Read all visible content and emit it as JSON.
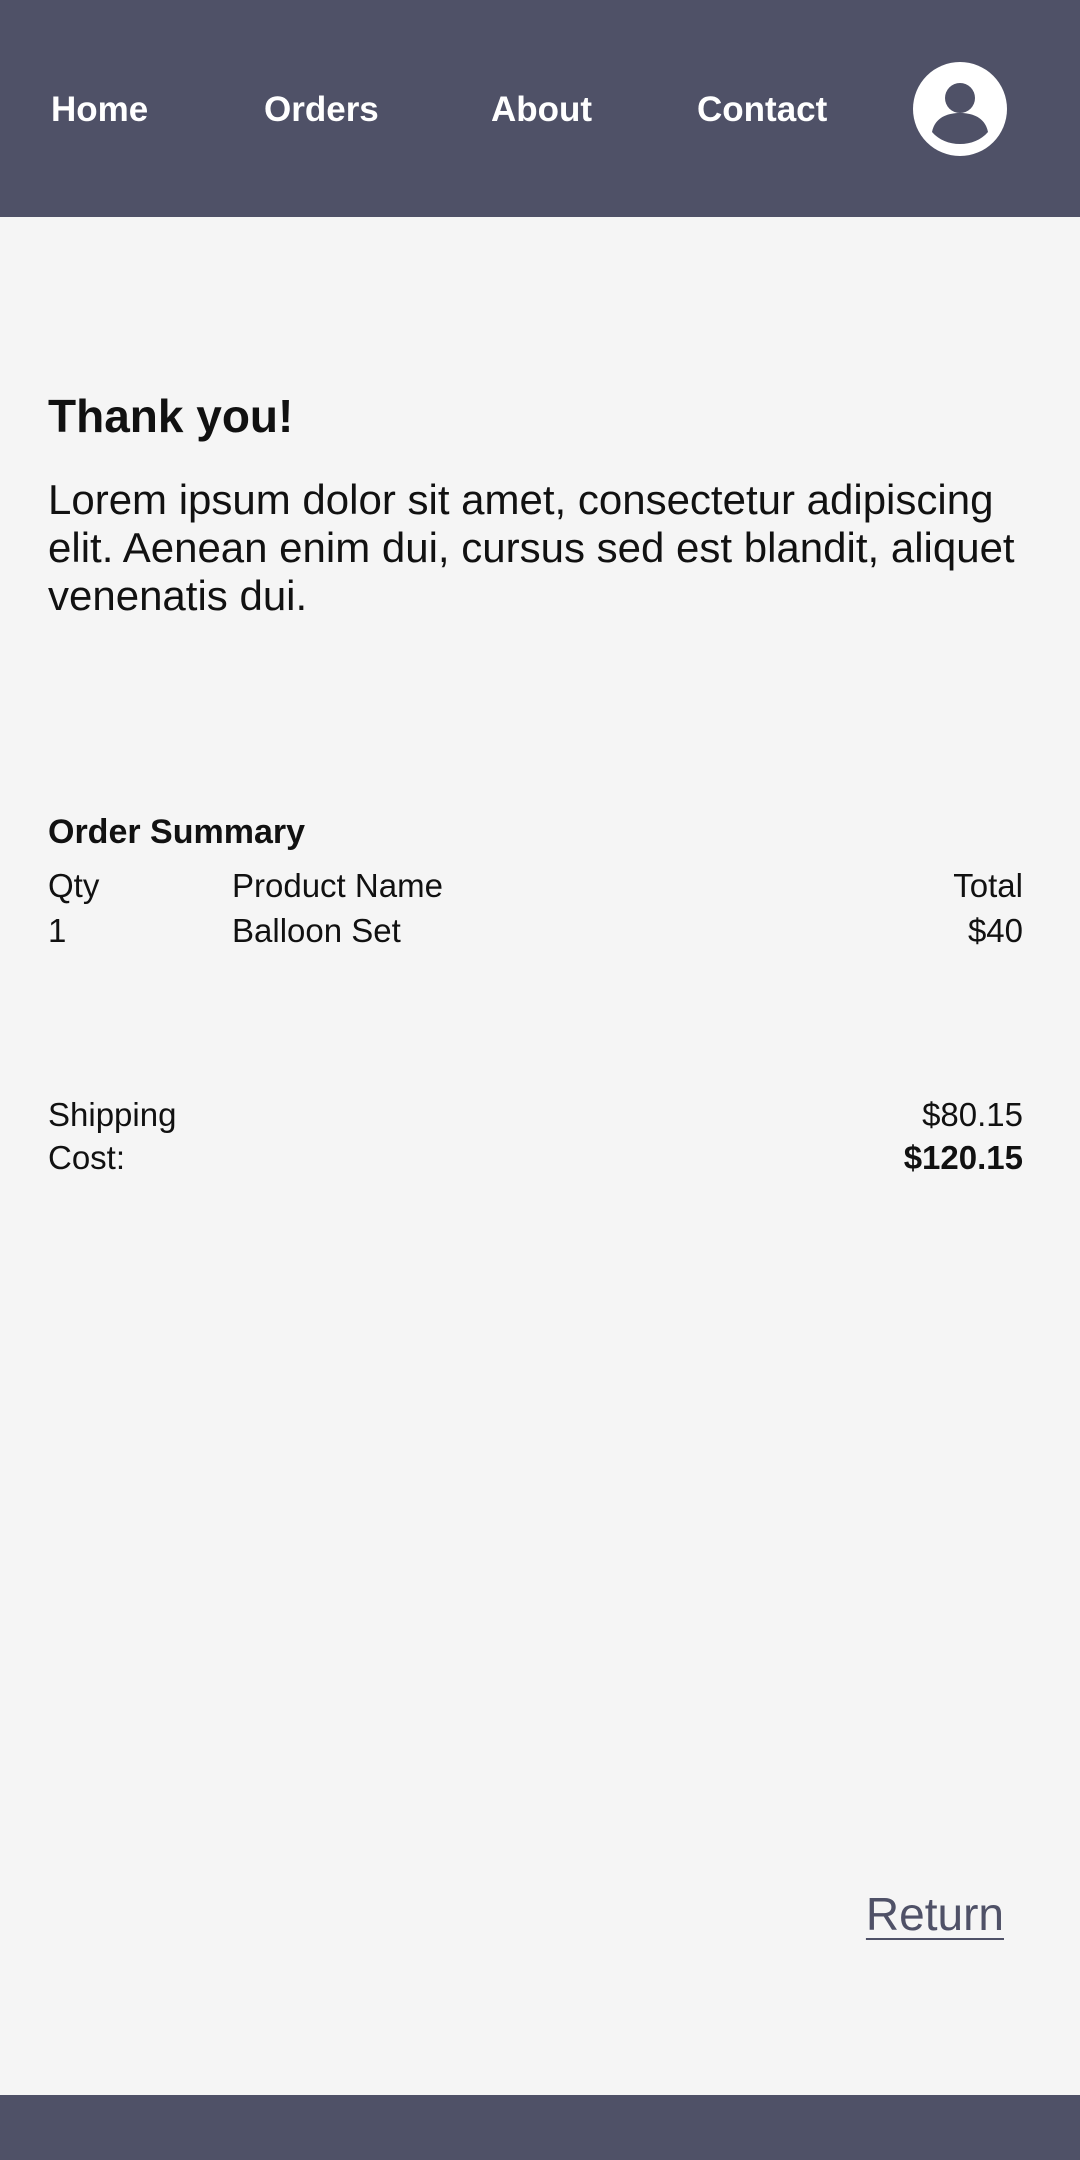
{
  "nav": {
    "items": [
      {
        "label": "Home"
      },
      {
        "label": "Orders"
      },
      {
        "label": "About"
      },
      {
        "label": "Contact"
      }
    ],
    "avatar_icon": "user-avatar-icon"
  },
  "main": {
    "heading": "Thank you!",
    "lead": "Lorem ipsum dolor sit amet, consectetur adipiscing elit. Aenean enim dui, cursus sed est blandit, aliquet venenatis dui."
  },
  "summary": {
    "title": "Order Summary",
    "columns": {
      "qty": "Qty",
      "name": "Product Name",
      "total": "Total"
    },
    "rows": [
      {
        "qty": "1",
        "name": "Balloon Set",
        "total": "$40"
      }
    ],
    "shipping_label": "Shipping",
    "shipping_value": "$80.15",
    "cost_label": "Cost:",
    "cost_value": "$120.15"
  },
  "actions": {
    "return_label": "Return"
  },
  "colors": {
    "header_bg": "#4f5167",
    "page_bg": "#f5f5f5",
    "link": "#4f5167"
  }
}
